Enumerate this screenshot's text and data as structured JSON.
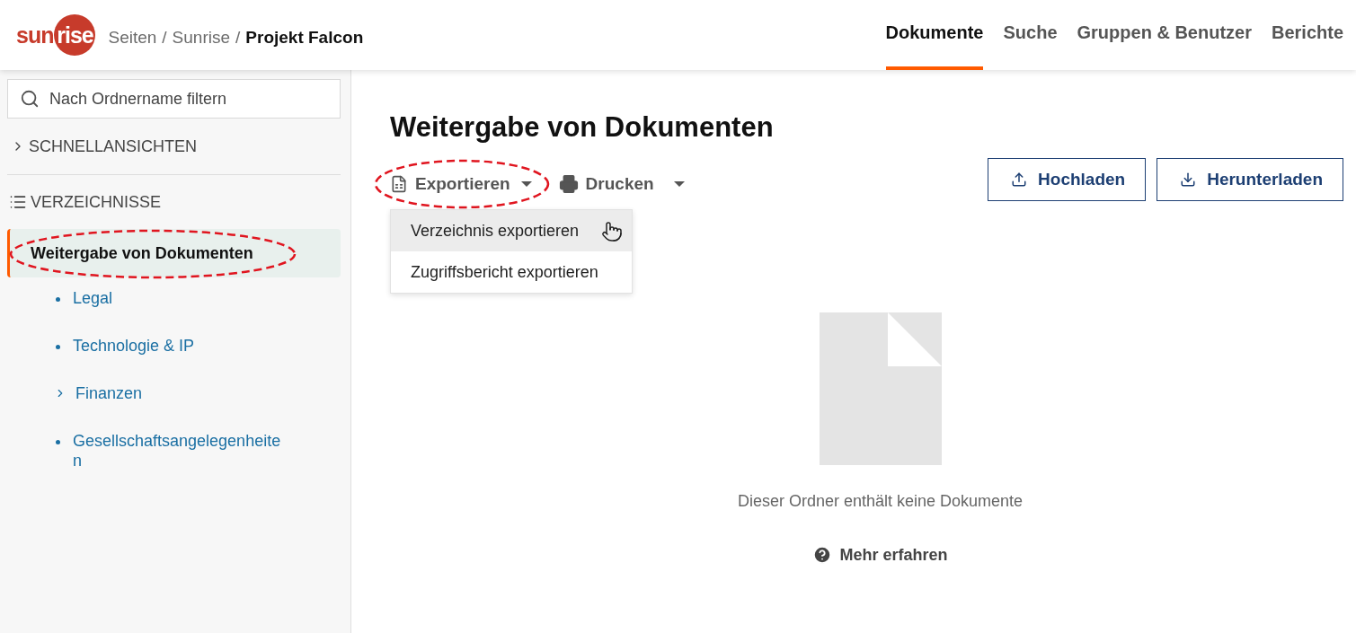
{
  "logo": {
    "part1": "sun",
    "part2": "rise"
  },
  "breadcrumb": [
    {
      "label": "Seiten",
      "current": false
    },
    {
      "label": "Sunrise",
      "current": false
    },
    {
      "label": "Projekt Falcon",
      "current": true
    }
  ],
  "breadcrumb_separator": "/",
  "nav_tabs": [
    {
      "label": "Dokumente",
      "selected": true
    },
    {
      "label": "Suche",
      "selected": false
    },
    {
      "label": "Gruppen & Benutzer",
      "selected": false
    },
    {
      "label": "Berichte",
      "selected": false
    }
  ],
  "sidebar": {
    "search": {
      "placeholder": "Nach Ordnername filtern"
    },
    "quick_views": {
      "label": "SCHNELLANSICHTEN",
      "expanded": false
    },
    "directories": {
      "label": "VERZEICHNISSE"
    },
    "tree": [
      {
        "label": "Weitergabe von Dokumenten",
        "selected": true,
        "annotated": true,
        "children": [
          {
            "label": "Legal",
            "kind": "leaf",
            "selected": false
          },
          {
            "label": "Technologie & IP",
            "kind": "leaf",
            "selected": false
          },
          {
            "label": "Finanzen",
            "kind": "folder",
            "selected": false
          },
          {
            "label": "Gesellschaftsangelegenheiten",
            "kind": "leaf",
            "selected": false
          }
        ]
      }
    ]
  },
  "main": {
    "title": "Weitergabe von Dokumenten",
    "toolbar": [
      {
        "label": "Exportieren",
        "kind": "export",
        "annotated": true,
        "expanded": true
      },
      {
        "label": "Drucken",
        "kind": "print",
        "annotated": false,
        "expanded": false
      }
    ],
    "export_menu": [
      {
        "label": "Verzeichnis exportieren",
        "hovered": true
      },
      {
        "label": "Zugriffsbericht exportieren",
        "hovered": false
      }
    ],
    "actions": [
      {
        "label": "Hochladen",
        "kind": "upload"
      },
      {
        "label": "Herunterladen",
        "kind": "download"
      }
    ],
    "empty_state": {
      "message": "Dieser Ordner enthält keine Dokumente",
      "link": "Mehr erfahren"
    }
  }
}
